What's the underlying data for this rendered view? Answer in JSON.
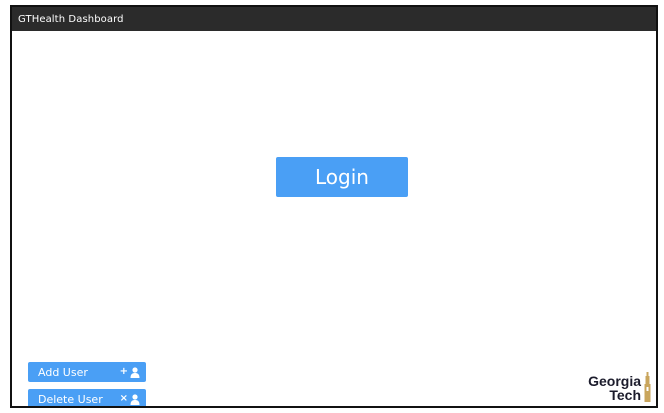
{
  "app": {
    "title": "GTHealth Dashboard"
  },
  "main": {
    "login_label": "Login"
  },
  "footer": {
    "add_user_label": "Add User",
    "add_user_symbol": "+",
    "delete_user_label": "Delete User",
    "delete_user_symbol": "×",
    "logo_line1": "Georgia",
    "logo_line2": "Tech"
  },
  "colors": {
    "accent": "#4a9ff5",
    "titlebar": "#2b2b2b",
    "logo_gold": "#c9a55c"
  },
  "icons": {
    "user_icon": "user-icon",
    "tower_icon": "tech-tower-icon"
  }
}
